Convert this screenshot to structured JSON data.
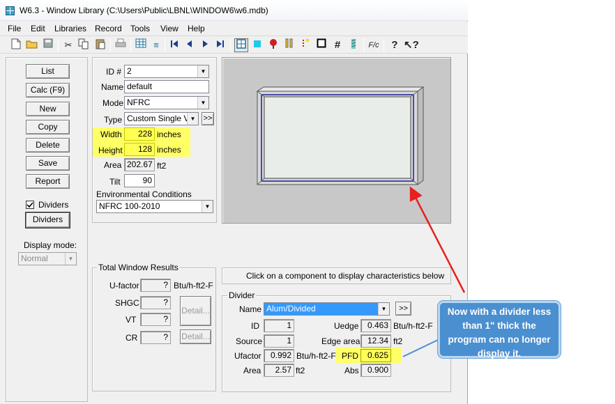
{
  "window": {
    "title": "W6.3 - Window Library (C:\\Users\\Public\\LBNL\\WINDOW6\\w6.mdb)"
  },
  "menu": [
    "File",
    "Edit",
    "Libraries",
    "Record",
    "Tools",
    "View",
    "Help"
  ],
  "toolbar": {
    "icons": [
      "new-file-icon",
      "open-folder-icon",
      "save-disk-icon",
      "cut-icon",
      "copy-icon",
      "paste-icon",
      "print-icon",
      "grid-icon",
      "list-icon",
      "first-record-icon",
      "previous-record-icon",
      "next-record-icon",
      "last-record-icon",
      "frame-view-icon",
      "glass-icon",
      "thermal-icon",
      "divider-bars-icon",
      "color-icon",
      "square-icon",
      "hash-icon",
      "hatch-icon",
      "fraction-icon",
      "help-icon",
      "context-help-icon"
    ]
  },
  "left_buttons": {
    "list": "List",
    "calc": "Calc (F9)",
    "new": "New",
    "copy": "Copy",
    "delete": "Delete",
    "save": "Save",
    "report": "Report"
  },
  "dividers": {
    "checkbox_label": "Dividers",
    "checked": true,
    "button_label": "Dividers"
  },
  "display_mode": {
    "label": "Display mode:",
    "value": "Normal"
  },
  "props": {
    "id_label": "ID #",
    "id_value": "2",
    "name_label": "Name",
    "name_value": "default",
    "mode_label": "Mode",
    "mode_value": "NFRC",
    "type_label": "Type",
    "type_value": "Custom Single Visi",
    "type_more": ">>",
    "width_label": "Width",
    "width_value": "228",
    "width_unit": "inches",
    "height_label": "Height",
    "height_value": "128",
    "height_unit": "inches",
    "area_label": "Area",
    "area_value": "202.67",
    "area_unit": "ft2",
    "tilt_label": "Tilt",
    "tilt_value": "90",
    "env_label": "Environmental Conditions",
    "env_value": "NFRC 100-2010"
  },
  "results": {
    "title": "Total Window Results",
    "ufactor_label": "U-factor",
    "ufactor_value": "?",
    "ufactor_unit": "Btu/h-ft2-F",
    "shgc_label": "SHGC",
    "shgc_value": "?",
    "vt_label": "VT",
    "vt_value": "?",
    "cr_label": "CR",
    "cr_value": "?",
    "detail1": "Detail...",
    "detail2": "Detail..."
  },
  "hint": "Click on a component to display characteristics below",
  "divider": {
    "title": "Divider",
    "name_label": "Name",
    "name_value": "Alum/Divided",
    "more": ">>",
    "id_label": "ID",
    "id_value": "1",
    "uedge_label": "Uedge",
    "uedge_value": "0.463",
    "uedge_unit": "Btu/h-ft2-F",
    "source_label": "Source",
    "source_value": "1",
    "edge_area_label": "Edge area",
    "edge_area_value": "12.34",
    "edge_area_unit": "ft2",
    "ufactor_label": "Ufactor",
    "ufactor_value": "0.992",
    "ufactor_unit": "Btu/h-ft2-F",
    "pfd_label": "PFD",
    "pfd_value": "0.625",
    "area_label": "Area",
    "area_value": "2.57",
    "area_unit": "ft2",
    "abs_label": "Abs",
    "abs_value": "0.900"
  },
  "callout": {
    "text": "Now with a divider less than 1\" thick the program can no longer display it."
  },
  "colors": {
    "highlight": "#ffff66",
    "callout": "#4a8fd0",
    "arrow": "#e82020",
    "selection": "#3399ff"
  }
}
